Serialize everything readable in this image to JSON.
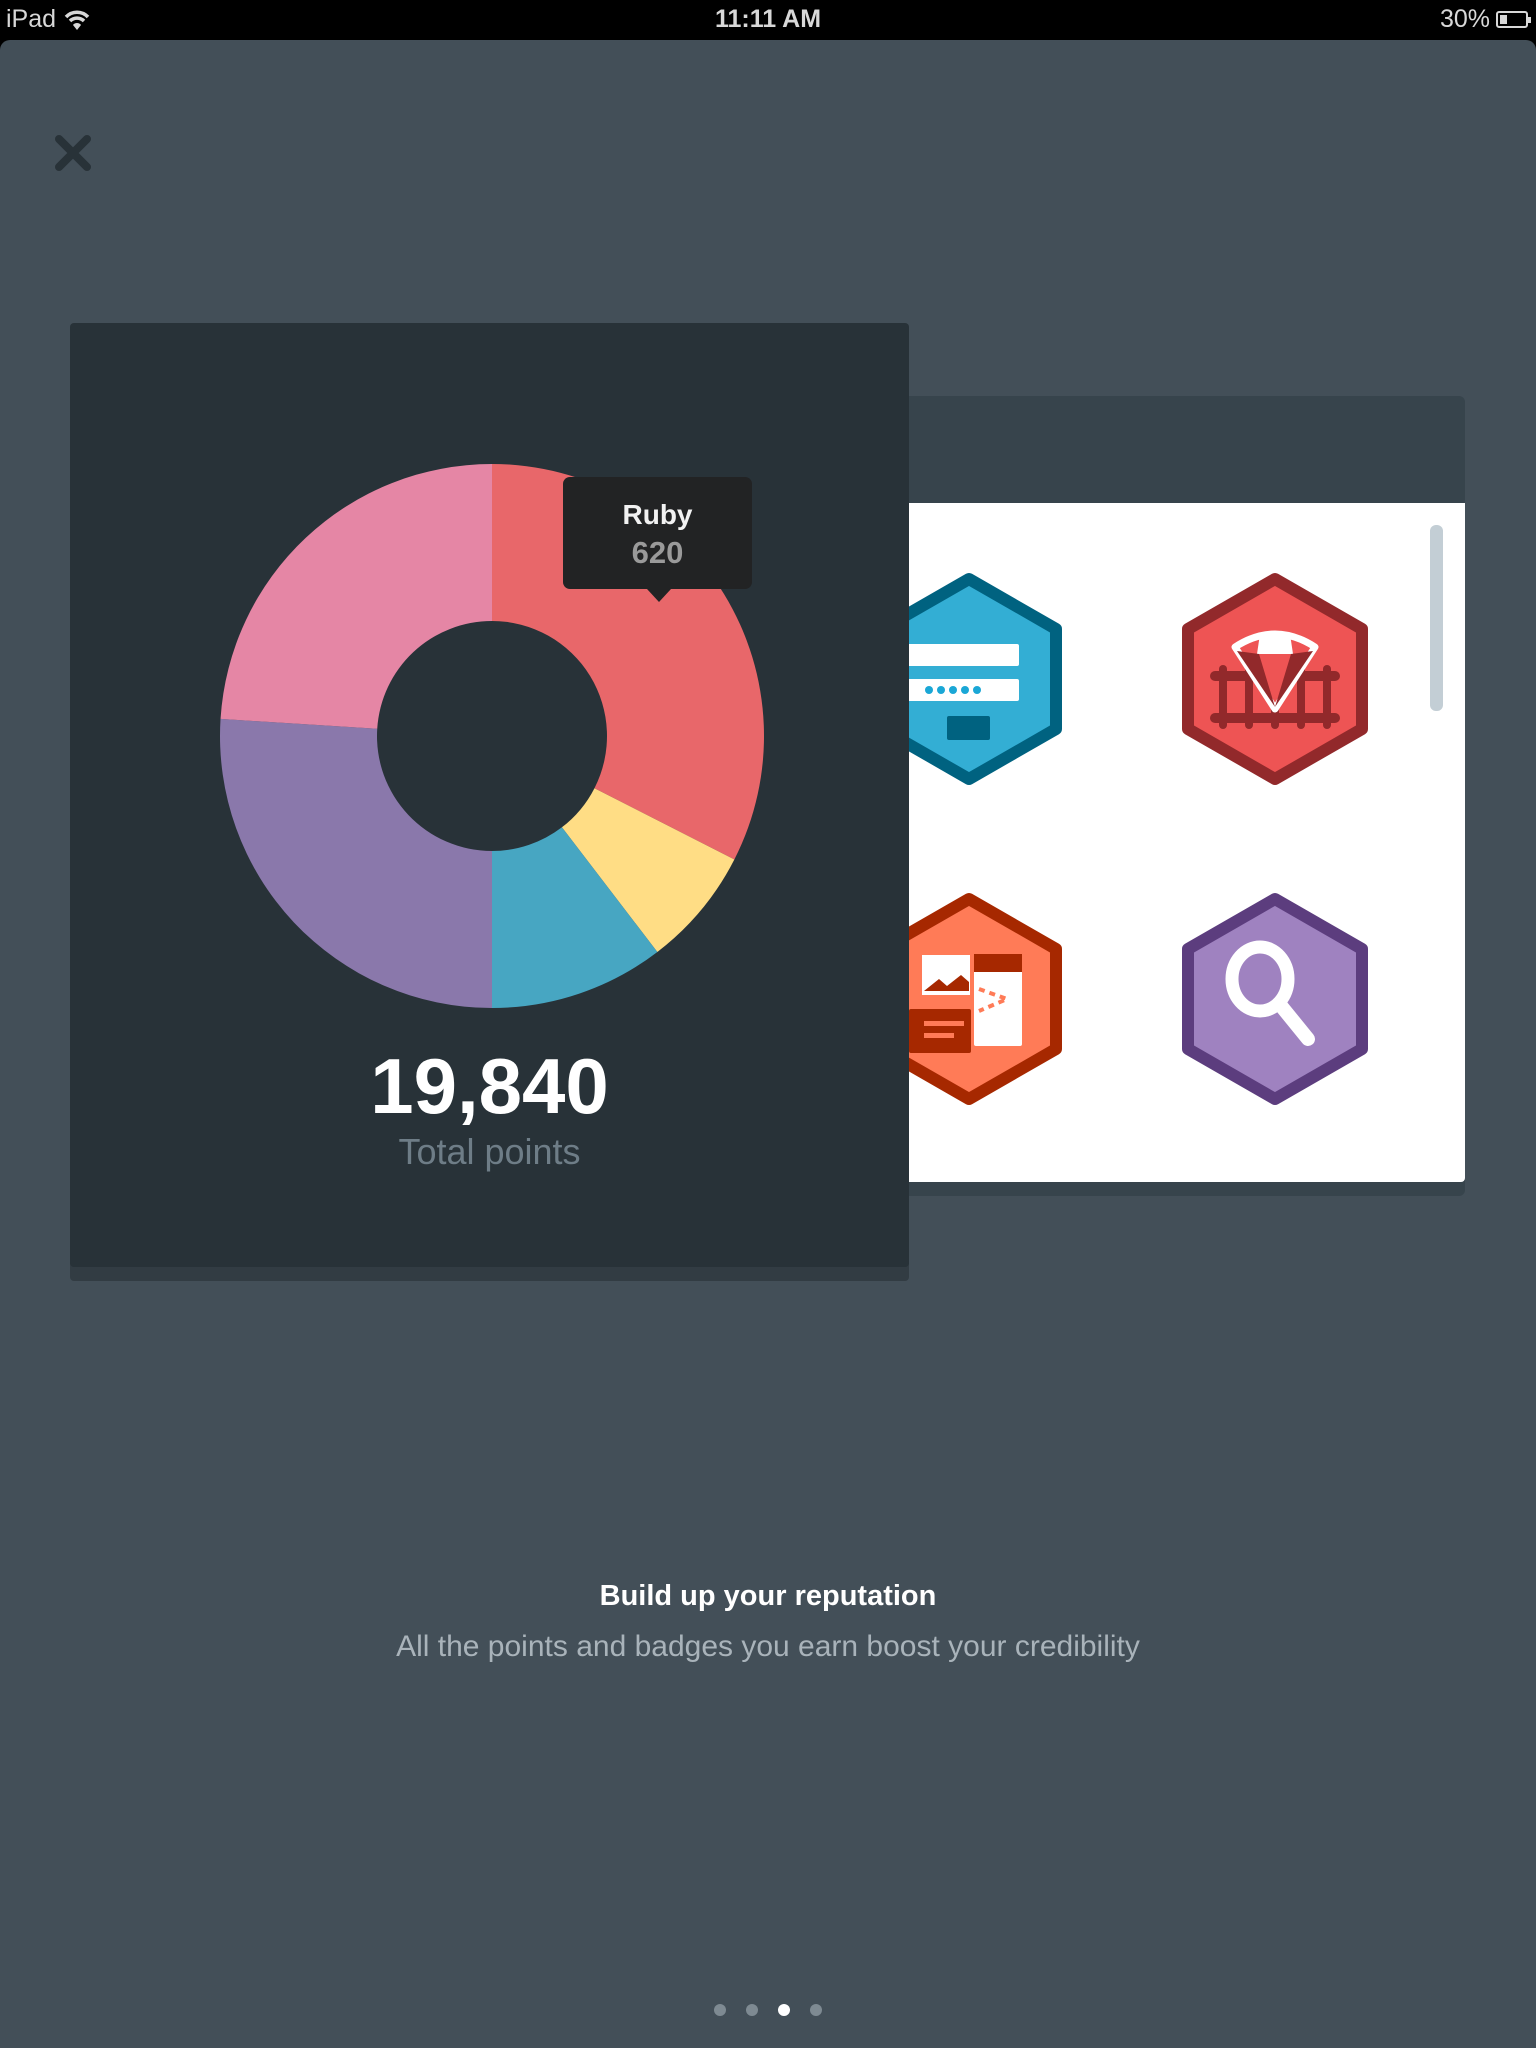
{
  "status_bar": {
    "device": "iPad",
    "time": "11:11 AM",
    "battery": "30%",
    "battery_level": 0.3
  },
  "close_icon": "close-icon",
  "badges": [
    {
      "name": "login-form-badge",
      "fill": "#33aed4",
      "border": "#006280"
    },
    {
      "name": "ruby-on-rails-badge",
      "fill": "#ee5454",
      "border": "#92292b"
    },
    {
      "name": "image-layout-badge",
      "fill": "#ff7b57",
      "border": "#a62800"
    },
    {
      "name": "search-badge",
      "fill": "#9f82c0",
      "border": "#5c3d7e"
    }
  ],
  "chart_data": {
    "type": "pie",
    "donut": true,
    "slices": [
      {
        "label": "Ruby",
        "value": 32.5,
        "color": "#e8676a"
      },
      {
        "value": 7.1,
        "color": "#ffdd85"
      },
      {
        "value": 10.4,
        "color": "#47a6c2"
      },
      {
        "value": 26.0,
        "color": "#8a78ab"
      },
      {
        "value": 24.0,
        "color": "#e586a5"
      }
    ],
    "tooltip": {
      "label": "Ruby",
      "value": "620"
    }
  },
  "summary": {
    "total": "19,840",
    "total_label": "Total points"
  },
  "onboarding": {
    "title": "Build up your reputation",
    "subtitle": "All the points and badges you earn boost your credibility",
    "page_count": 4,
    "active_page": 3
  }
}
